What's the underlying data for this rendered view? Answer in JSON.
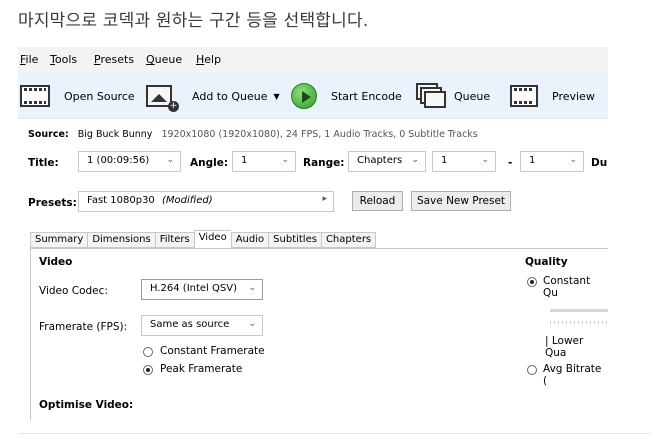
{
  "caption": "마지막으로 코덱과 원하는 구간 등을 선택합니다.",
  "menu": {
    "file": {
      "u": "F",
      "rest": "ile"
    },
    "tools": {
      "u": "T",
      "rest": "ools"
    },
    "presets": {
      "u": "P",
      "rest": "resets"
    },
    "queue": {
      "u": "Q",
      "rest": "ueue"
    },
    "help": {
      "u": "H",
      "rest": "elp"
    }
  },
  "toolbar": {
    "open_source": "Open Source",
    "add_to_queue": "Add to Queue",
    "add_to_queue_caret": "▼",
    "start_encode": "Start Encode",
    "queue": "Queue",
    "preview": "Preview",
    "accent_green": "#3aa935"
  },
  "source": {
    "label": "Source:",
    "title": "Big Buck Bunny",
    "details": "1920x1080 (1920x1080), 24 FPS, 1 Audio Tracks, 0 Subtitle Tracks"
  },
  "title_row": {
    "title_label": "Title:",
    "title_value": "1 (00:09:56)",
    "angle_label": "Angle:",
    "angle_value": "1",
    "range_label": "Range:",
    "range_type": "Chapters",
    "range_start": "1",
    "dash": "-",
    "range_end": "1",
    "duration_label": "Du"
  },
  "presets": {
    "label": "Presets:",
    "value": "Fast 1080p30",
    "modified": "(Modified)",
    "arrow": "▸",
    "reload": "Reload",
    "save_new": "Save New Preset"
  },
  "tabs": [
    "Summary",
    "Dimensions",
    "Filters",
    "Video",
    "Audio",
    "Subtitles",
    "Chapters"
  ],
  "active_tab": "Video",
  "video": {
    "section_title": "Video",
    "codec_label": "Video Codec:",
    "codec_value": "H.264 (Intel QSV)",
    "framerate_label": "Framerate (FPS):",
    "framerate_value": "Same as source",
    "constant_framerate": "Constant Framerate",
    "peak_framerate": "Peak Framerate",
    "selected_framerate_mode": "Peak Framerate",
    "optimise_label": "Optimise Video:"
  },
  "quality": {
    "section_title": "Quality",
    "constant_quality": "Constant Qu",
    "lower_quality": "| Lower Qua",
    "avg_bitrate": "Avg Bitrate (",
    "selected_mode": "Constant Quality"
  }
}
